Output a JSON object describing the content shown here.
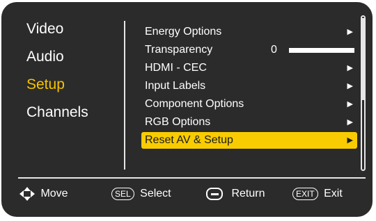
{
  "left_menu": {
    "items": [
      {
        "label": "Video"
      },
      {
        "label": "Audio"
      },
      {
        "label": "Setup"
      },
      {
        "label": "Channels"
      }
    ]
  },
  "right_menu": {
    "items": [
      {
        "label": "Energy Options",
        "arrow": "▶"
      },
      {
        "label": "Transparency",
        "value": "0"
      },
      {
        "label": "HDMI - CEC",
        "arrow": "▶"
      },
      {
        "label": "Input Labels",
        "arrow": "▶"
      },
      {
        "label": "Component Options",
        "arrow": "▶"
      },
      {
        "label": "RGB Options",
        "arrow": "▶"
      },
      {
        "label": "Reset AV & Setup",
        "arrow": "▶"
      }
    ],
    "selected_index": 6
  },
  "footer": {
    "move": {
      "label": "Move",
      "icon": "four-way-arrows-icon"
    },
    "select": {
      "key": "SEL",
      "label": "Select"
    },
    "return": {
      "icon": "minus-button-icon",
      "label": "Return"
    },
    "exit": {
      "key": "EXIT",
      "label": "Exit"
    }
  },
  "colors": {
    "background": "#2b2b2b",
    "accent": "#f8cc00",
    "active_text": "#f6c300",
    "text": "#ffffff"
  }
}
